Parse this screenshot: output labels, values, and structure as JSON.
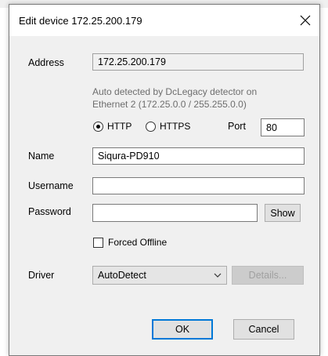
{
  "dialog": {
    "title": "Edit device 172.25.200.179",
    "address_label": "Address",
    "address_value": "172.25.200.179",
    "hint_line1": "Auto detected by DcLegacy detector on",
    "hint_line2": "Ethernet 2 (172.25.0.0 / 255.255.0.0)",
    "protocol": {
      "http_label": "HTTP",
      "https_label": "HTTPS",
      "selected": "HTTP"
    },
    "port_label": "Port",
    "port_value": "80",
    "name_label": "Name",
    "name_value": "Siqura-PD910",
    "username_label": "Username",
    "username_value": "",
    "password_label": "Password",
    "password_value": "",
    "show_button": "Show",
    "forced_offline_label": "Forced Offline",
    "forced_offline_checked": false,
    "driver_label": "Driver",
    "driver_value": "AutoDetect",
    "details_button": "Details...",
    "ok_button": "OK",
    "cancel_button": "Cancel"
  },
  "icons": {
    "close": "close-icon",
    "dropdown": "chevron-down-icon"
  },
  "colors": {
    "dialog_bg": "#f0f0f0",
    "default_button_border": "#0078d7",
    "hint_text": "#6d6d6d"
  }
}
